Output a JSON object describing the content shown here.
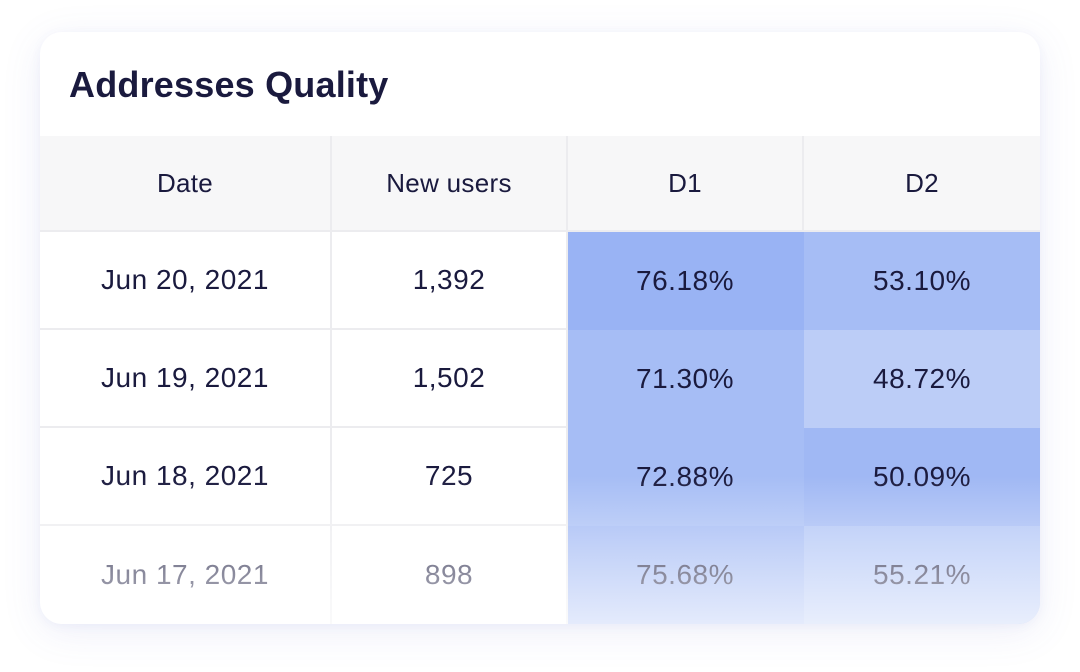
{
  "card": {
    "title": "Addresses Quality"
  },
  "table": {
    "columns": [
      "Date",
      "New users",
      "D1",
      "D2"
    ],
    "rows": [
      {
        "date": "Jun 20, 2021",
        "new_users": "1,392",
        "d1": "76.18%",
        "d2": "53.10%"
      },
      {
        "date": "Jun 19, 2021",
        "new_users": "1,502",
        "d1": "71.30%",
        "d2": "48.72%"
      },
      {
        "date": "Jun 18, 2021",
        "new_users": "725",
        "d1": "72.88%",
        "d2": "50.09%"
      },
      {
        "date": "Jun 17, 2021",
        "new_users": "898",
        "d1": "75.68%",
        "d2": "55.21%"
      }
    ]
  },
  "colors": {
    "title_text": "#1a1a3e",
    "header_bg": "#f7f7f8",
    "heat_strong": "#99b3f4",
    "heat_medium": "#a6bdf5",
    "heat_light": "#bccdf7"
  }
}
